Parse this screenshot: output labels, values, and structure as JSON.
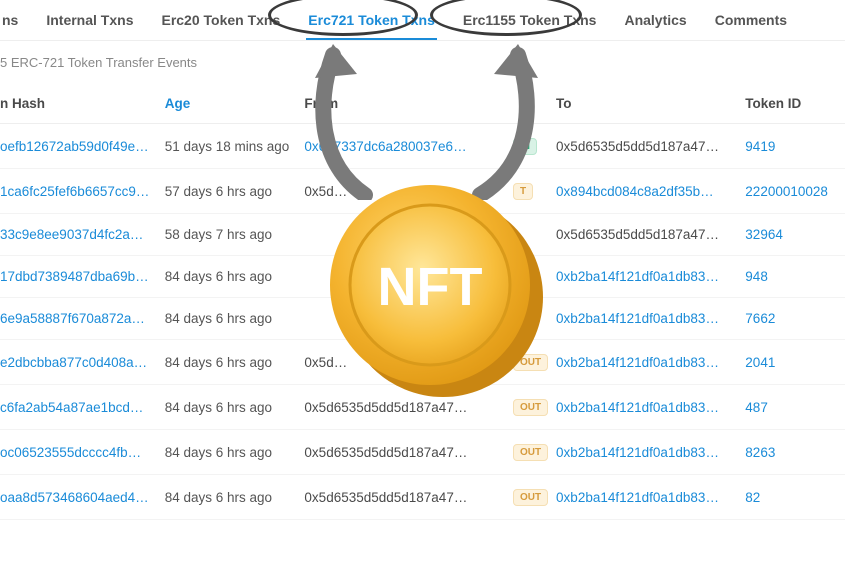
{
  "tabs": {
    "items": [
      {
        "label": "ns",
        "active": false,
        "name": "tab-txns"
      },
      {
        "label": "Internal Txns",
        "active": false,
        "name": "tab-internal-txns"
      },
      {
        "label": "Erc20 Token Txns",
        "active": false,
        "name": "tab-erc20"
      },
      {
        "label": "Erc721 Token Txns",
        "active": true,
        "name": "tab-erc721"
      },
      {
        "label": "Erc1155 Token Txns",
        "active": false,
        "name": "tab-erc1155"
      },
      {
        "label": "Analytics",
        "active": false,
        "name": "tab-analytics"
      },
      {
        "label": "Comments",
        "active": false,
        "name": "tab-comments"
      }
    ]
  },
  "subheader": "5 ERC-721 Token Transfer Events",
  "columns": {
    "hash": "n Hash",
    "age": "Age",
    "from": "From",
    "to": "To",
    "token": "Token ID"
  },
  "rows": [
    {
      "hash": "oefb12672ab59d0f49e…",
      "age": "51 days 18 mins ago",
      "from": "0x657337dc6a280037e6…",
      "from_link": true,
      "dir": "IN",
      "to": "0x5d6535d5dd5d187a47…",
      "to_link": false,
      "token": "9419"
    },
    {
      "hash": "1ca6fc25fef6b6657cc9…",
      "age": "57 days 6 hrs ago",
      "from": "0x5d…",
      "from_link": false,
      "dir": "T",
      "to": "0x894bcd084c8a2df35b…",
      "to_link": true,
      "token": "22200010028"
    },
    {
      "hash": "33c9e8ee9037d4fc2a…",
      "age": "58 days 7 hrs ago",
      "from": "",
      "from_link": false,
      "dir": "",
      "to": "0x5d6535d5dd5d187a47…",
      "to_link": false,
      "token": "32964"
    },
    {
      "hash": "17dbd7389487dba69b…",
      "age": "84 days 6 hrs ago",
      "from": "",
      "from_link": false,
      "dir": "",
      "to": "0xb2ba14f121df0a1db83…",
      "to_link": true,
      "token": "948"
    },
    {
      "hash": "6e9a58887f670a872a…",
      "age": "84 days 6 hrs ago",
      "from": "",
      "from_link": false,
      "dir": "",
      "to": "0xb2ba14f121df0a1db83…",
      "to_link": true,
      "token": "7662"
    },
    {
      "hash": "e2dbcbba877c0d408a…",
      "age": "84 days 6 hrs ago",
      "from": "0x5d…",
      "from_link": false,
      "dir": "OUT",
      "to": "0xb2ba14f121df0a1db83…",
      "to_link": true,
      "token": "2041"
    },
    {
      "hash": "c6fa2ab54a87ae1bcd…",
      "age": "84 days 6 hrs ago",
      "from": "0x5d6535d5dd5d187a47…",
      "from_link": false,
      "dir": "OUT",
      "to": "0xb2ba14f121df0a1db83…",
      "to_link": true,
      "token": "487"
    },
    {
      "hash": "oc06523555dcccc4fb…",
      "age": "84 days 6 hrs ago",
      "from": "0x5d6535d5dd5d187a47…",
      "from_link": false,
      "dir": "OUT",
      "to": "0xb2ba14f121df0a1db83…",
      "to_link": true,
      "token": "8263"
    },
    {
      "hash": "oaa8d573468604aed4…",
      "age": "84 days 6 hrs ago",
      "from": "0x5d6535d5dd5d187a47…",
      "from_link": false,
      "dir": "OUT",
      "to": "0xb2ba14f121df0a1db83…",
      "to_link": true,
      "token": "82"
    }
  ],
  "annotations": {
    "coin_label": "NFT"
  }
}
